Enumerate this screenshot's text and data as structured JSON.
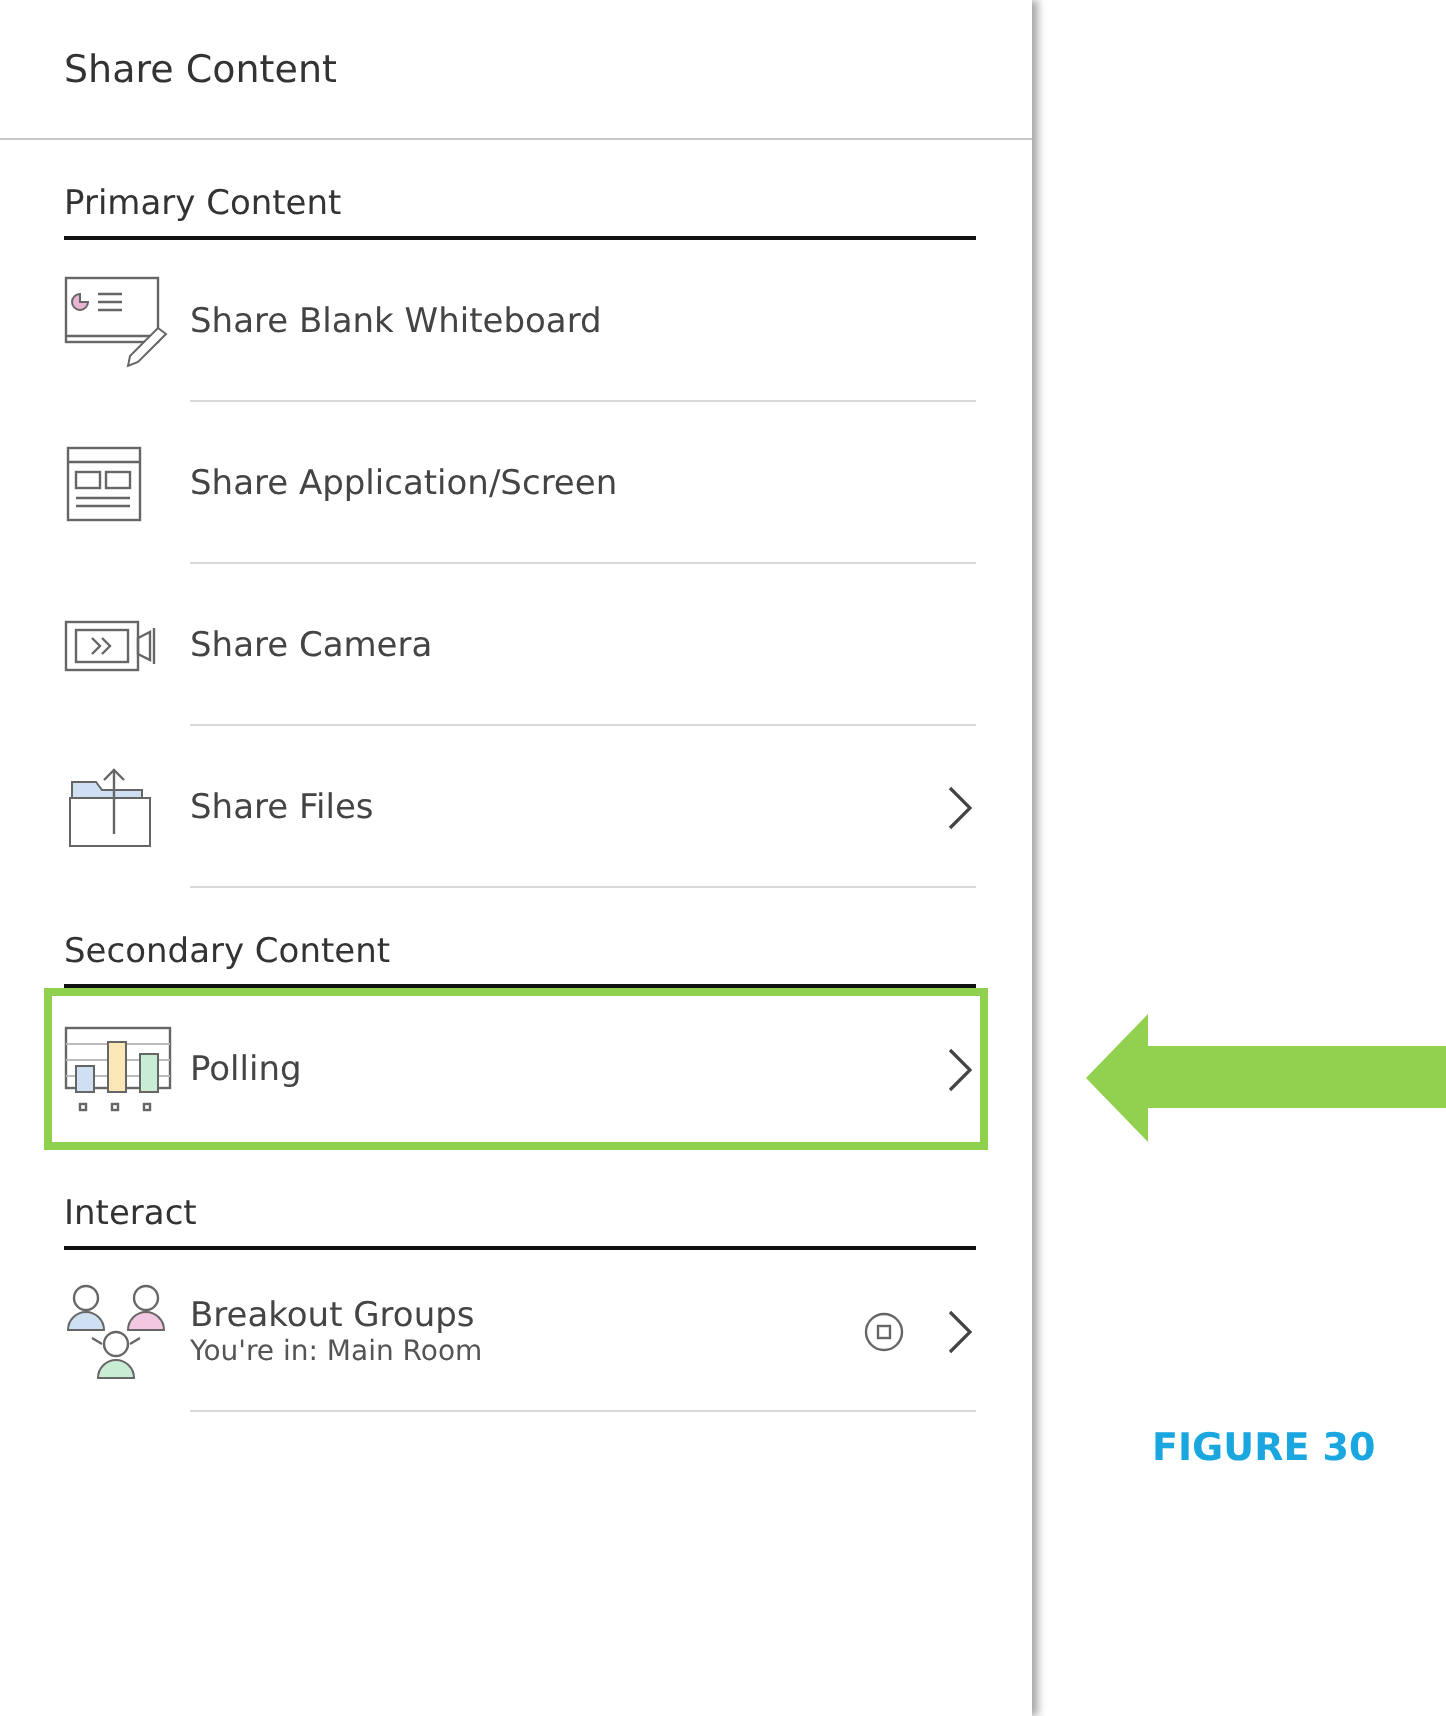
{
  "panel": {
    "title": "Share Content",
    "sections": [
      {
        "heading": "Primary Content",
        "items": [
          {
            "label": "Share Blank Whiteboard",
            "chevron": false,
            "highlighted": false
          },
          {
            "label": "Share Application/Screen",
            "chevron": false,
            "highlighted": false
          },
          {
            "label": "Share Camera",
            "chevron": false,
            "highlighted": false
          },
          {
            "label": "Share Files",
            "chevron": true,
            "highlighted": false
          }
        ]
      },
      {
        "heading": "Secondary Content",
        "items": [
          {
            "label": "Polling",
            "chevron": true,
            "highlighted": true
          }
        ]
      },
      {
        "heading": "Interact",
        "items": [
          {
            "label": "Breakout Groups",
            "subtitle": "You're in: Main Room",
            "chevron": true,
            "highlighted": false,
            "badge": true
          }
        ]
      }
    ]
  },
  "caption": "FIGURE 30"
}
